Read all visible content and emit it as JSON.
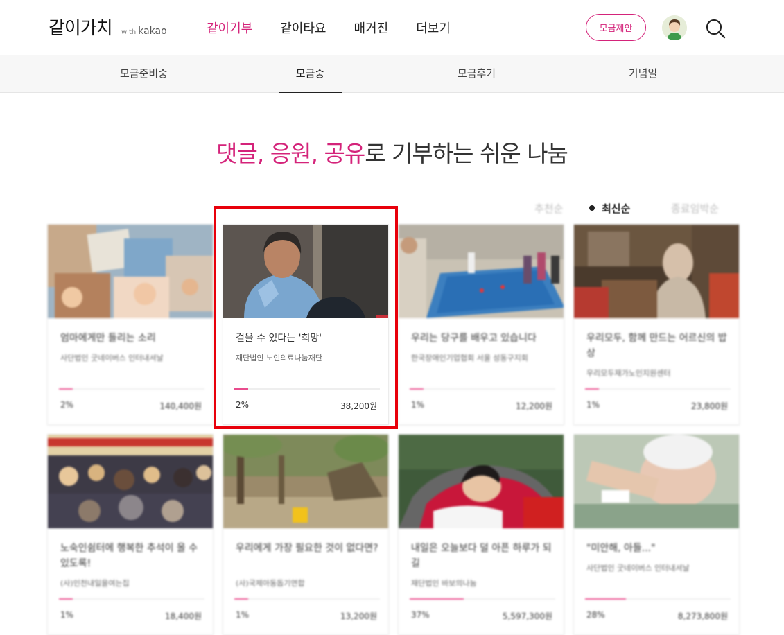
{
  "header": {
    "logo": "같이가치",
    "logo_with": "with",
    "logo_brand": "kakao",
    "nav": [
      "같이기부",
      "같이타요",
      "매거진",
      "더보기"
    ],
    "propose_button": "모금제안"
  },
  "subnav": [
    "모금준비중",
    "모금중",
    "모금후기",
    "기념일"
  ],
  "headline": {
    "pink": "댓글, 응원, 공유",
    "rest": "로 기부하는 쉬운 나눔"
  },
  "sort": [
    "추천순",
    "최신순",
    "종료임박순"
  ],
  "cards": [
    {
      "title": "엄마에게만 들리는 소리",
      "org": "사단법인 굿네이버스 인터내셔날",
      "pct": "2%",
      "amount": "140,400원",
      "progress": 0.02
    },
    {
      "title": "걸을 수 있다는 '희망'",
      "org": "재단법인 노인의료나눔재단",
      "pct": "2%",
      "amount": "38,200원",
      "progress": 0.02
    },
    {
      "title": "우리는 당구를 배우고 있습니다",
      "org": "한국장애인기업협회 서울 성동구지회",
      "pct": "1%",
      "amount": "12,200원",
      "progress": 0.01
    },
    {
      "title": "우리모두, 함께 만드는 어르신의 밥상",
      "org": "우리모두재가노인지원센터",
      "pct": "1%",
      "amount": "23,800원",
      "progress": 0.01
    },
    {
      "title": "노숙인쉼터에 행복한 추석이 올 수 있도록!",
      "org": "(사)인천내일을여는집",
      "pct": "1%",
      "amount": "18,400원",
      "progress": 0.01
    },
    {
      "title": "우리에게 가장 필요한 것이 없다면?",
      "org": "(사)국제아동돕기연합",
      "pct": "1%",
      "amount": "13,200원",
      "progress": 0.01
    },
    {
      "title": "내일은 오늘보다 덜 아픈 하루가 되길",
      "org": "재단법인 바보의나눔",
      "pct": "37%",
      "amount": "5,597,300원",
      "progress": 0.37
    },
    {
      "title": "\"미안해, 아들...\"",
      "org": "사단법인 굿네이버스 인터내셔날",
      "pct": "28%",
      "amount": "8,273,800원",
      "progress": 0.28
    }
  ],
  "colors": {
    "accent": "#d4237a",
    "progress": "#e94c8d",
    "highlight": "#e8000b"
  }
}
